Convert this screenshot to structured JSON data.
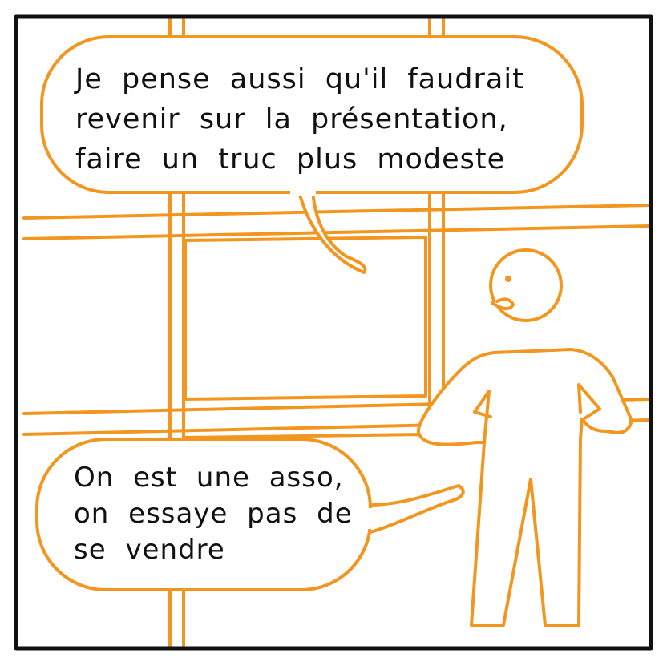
{
  "colors": {
    "line_orange": "#f2961f",
    "frame_black": "#111111",
    "background": "#ffffff",
    "text": "#111111"
  },
  "panel": {
    "top_bubble": {
      "lines": [
        "Je pense aussi qu'il faudrait",
        "revenir sur la présentation,",
        "faire un truc plus modeste"
      ]
    },
    "bottom_bubble": {
      "lines": [
        "On est une asso,",
        "on essaye pas de",
        "se vendre"
      ]
    },
    "character": {
      "icon": "person-silhouette-icon"
    }
  }
}
